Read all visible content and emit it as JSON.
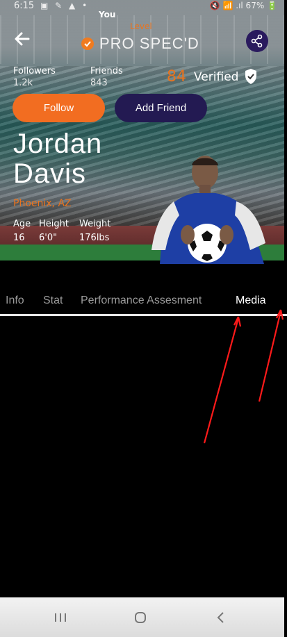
{
  "status": {
    "time": "6:15",
    "left_icons": "▣ ✎ ▲ •",
    "right_icons": "🔇 📶 .ıl 67% 🔋"
  },
  "user_label": "You",
  "level": {
    "label": "Level",
    "name": "PRO SPEC'D"
  },
  "counts": {
    "followers_label": "Followers",
    "followers_value": "1.2k",
    "friends_label": "Friends",
    "friends_value": "843"
  },
  "score": "84",
  "verified_label": "Verified",
  "buttons": {
    "follow": "Follow",
    "add_friend": "Add Friend"
  },
  "profile": {
    "first_name": "Jordan",
    "last_name": "Davis",
    "location": "Phoenix, AZ"
  },
  "attributes": [
    {
      "label": "Age",
      "value": "16"
    },
    {
      "label": "Height",
      "value": "6'0\""
    },
    {
      "label": "Weight",
      "value": "176lbs"
    }
  ],
  "tabs": [
    "Info",
    "Stat",
    "Performance Assesment",
    "Media"
  ],
  "active_tab": "Media",
  "colors": {
    "accent": "#f26d21",
    "secondary": "#231a52",
    "background": "#000000"
  }
}
